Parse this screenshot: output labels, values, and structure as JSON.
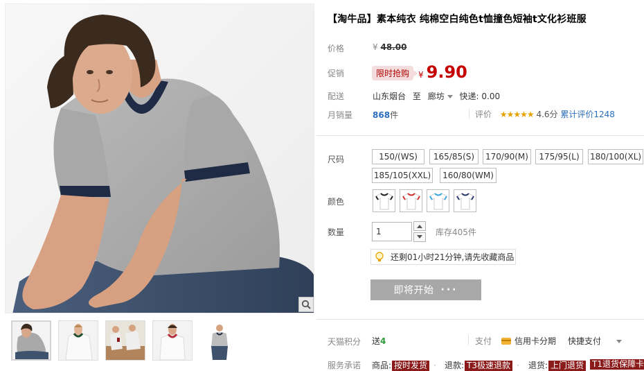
{
  "title": "【淘牛品】素本纯衣 纯棉空白纯色t恤撞色短袖t文化衫班服",
  "labels": {
    "price": "价格",
    "promo": "促销",
    "delivery": "配送",
    "monthly_sales": "月销量",
    "size": "尺码",
    "color": "颜色",
    "quantity": "数量",
    "tmall_points": "天猫积分",
    "service": "服务承诺"
  },
  "price": {
    "currency": "¥",
    "original": "48.00"
  },
  "promo": {
    "tag": "限时抢购",
    "currency": "¥",
    "price": "9.90"
  },
  "delivery": {
    "from": "山东烟台",
    "to_word": "至",
    "to": "廊坊",
    "express": "快递: 0.00"
  },
  "sales": {
    "count": "868",
    "unit": "件"
  },
  "rating": {
    "label": "评价",
    "stars": "★★★★★",
    "score": "4.6分",
    "total": "累计评价1248"
  },
  "sizes": [
    "150/(WS)",
    "165/85(S)",
    "170/90(M)",
    "175/95(L)",
    "180/100(XL)",
    "185/105(XXL)",
    "160/80(WM)"
  ],
  "colors": [
    "white-black-trim",
    "white-red-trim",
    "white-blue-trim",
    "white-navy-trim"
  ],
  "quantity": {
    "value": "1",
    "stock": "库存405件"
  },
  "notice": "还剩01小时21分钟,请先收藏商品",
  "buy": {
    "label": "即将开始",
    "dots": "···"
  },
  "points": {
    "prefix": "送",
    "value": "4"
  },
  "pay": {
    "label": "支付",
    "credit": "信用卡分期",
    "quick": "快捷支付"
  },
  "services": [
    {
      "label": "商品:",
      "tag": "按时发货",
      "color": "#8b1a1a"
    },
    {
      "label": "退款:",
      "tag": "T3极速退款",
      "color": "#8b1a1a"
    },
    {
      "label": "退货:",
      "tag": "上门退货",
      "color": "#8b1a1a"
    },
    {
      "label": "",
      "tag": "T1退货保障卡",
      "color": "#8b1a1a"
    }
  ],
  "colors_theme": {
    "accent": "#c40000",
    "link": "#2a6ebb",
    "button_disabled": "#a8a8a8"
  }
}
